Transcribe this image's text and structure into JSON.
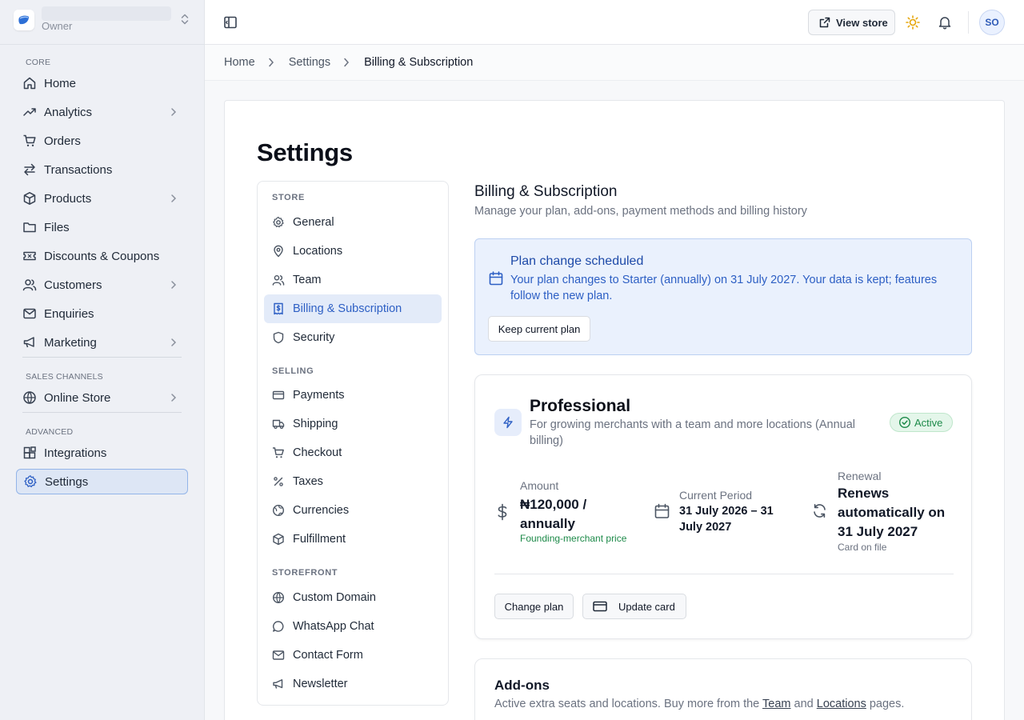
{
  "store": {
    "role": "Owner"
  },
  "sidebar": {
    "sections": {
      "core": "CORE",
      "sales_channels": "SALES CHANNELS",
      "advanced": "ADVANCED"
    },
    "items": {
      "home": "Home",
      "analytics": "Analytics",
      "orders": "Orders",
      "transactions": "Transactions",
      "products": "Products",
      "files": "Files",
      "discounts": "Discounts & Coupons",
      "customers": "Customers",
      "enquiries": "Enquiries",
      "marketing": "Marketing",
      "online_store": "Online Store",
      "integrations": "Integrations",
      "settings": "Settings"
    }
  },
  "topbar": {
    "view_store": "View store",
    "avatar_initials": "SO"
  },
  "breadcrumb": {
    "home": "Home",
    "settings": "Settings",
    "current": "Billing & Subscription"
  },
  "page": {
    "title": "Settings"
  },
  "settings_nav": {
    "sections": {
      "store": "STORE",
      "selling": "SELLING",
      "storefront": "STOREFRONT"
    },
    "items": {
      "general": "General",
      "locations": "Locations",
      "team": "Team",
      "billing": "Billing & Subscription",
      "security": "Security",
      "payments": "Payments",
      "shipping": "Shipping",
      "checkout": "Checkout",
      "taxes": "Taxes",
      "currencies": "Currencies",
      "fulfillment": "Fulfillment",
      "custom_domain": "Custom Domain",
      "whatsapp": "WhatsApp Chat",
      "contact_form": "Contact Form",
      "newsletter": "Newsletter"
    }
  },
  "content": {
    "title": "Billing & Subscription",
    "subtitle": "Manage your plan, add-ons, payment methods and billing history"
  },
  "alert": {
    "title": "Plan change scheduled",
    "text": "Your plan changes to Starter (annually) on 31 July 2027. Your data is kept; features follow the new plan.",
    "button": "Keep current plan"
  },
  "plan": {
    "name": "Professional",
    "description": "For growing merchants with a team and more locations (Annual billing)",
    "status": "Active",
    "amount_label": "Amount",
    "amount_value": "₦120,000 / annually",
    "amount_note": "Founding-merchant price",
    "period_label": "Current Period",
    "period_value": "31 July 2026 – 31 July 2027",
    "renewal_label": "Renewal",
    "renewal_value": "Renews automatically on 31 July 2027",
    "renewal_note": "Card on file",
    "change_plan": "Change plan",
    "update_card": "Update card"
  },
  "addons": {
    "title": "Add-ons",
    "sub_before": "Active extra seats and locations. Buy more from the",
    "team_link": "Team",
    "sub_mid": "and",
    "locations_link": "Locations",
    "sub_after": "pages."
  },
  "colors": {
    "accent": "#2d5fc4",
    "success": "#1d8a49",
    "sun": "#e5a50a"
  }
}
